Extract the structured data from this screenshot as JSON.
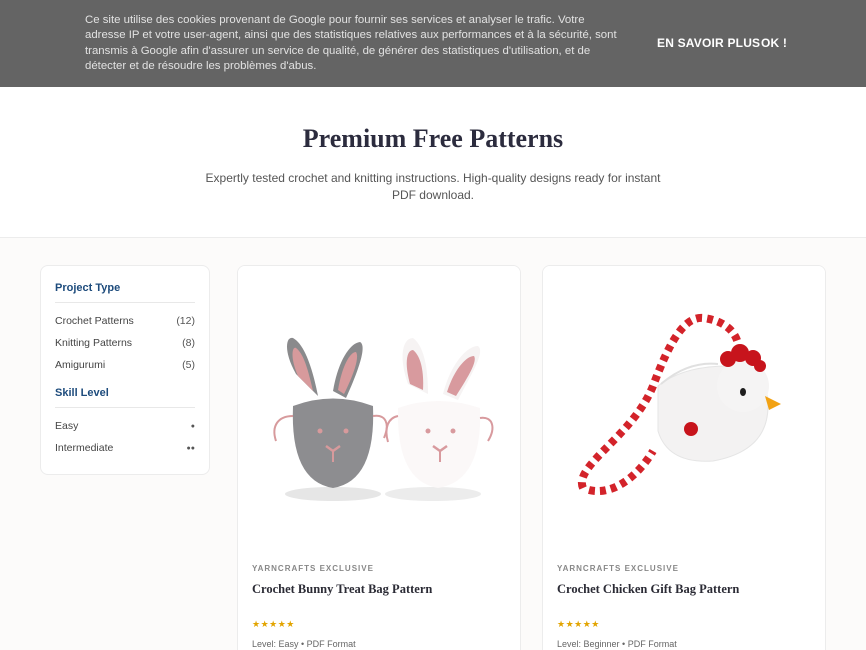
{
  "cookie_banner": {
    "text": "Ce site utilise des cookies provenant de Google pour fournir ses services et analyser le trafic. Votre adresse IP et votre user-agent, ainsi que des statistiques relatives aux performances et à la sécurité, sont transmis à Google afin d'assurer un service de qualité, de générer des statistiques d'utilisation, et de détecter et de résoudre les problèmes d'abus.",
    "learn_more": "EN SAVOIR PLUS",
    "ok": "OK !"
  },
  "hero": {
    "title": "Premium Free Patterns",
    "subtitle": "Expertly tested crochet and knitting instructions. High-quality designs ready for instant PDF download."
  },
  "sidebar": {
    "project_type_heading": "Project Type",
    "project_types": [
      {
        "label": "Crochet Patterns",
        "count": "(12)"
      },
      {
        "label": "Knitting Patterns",
        "count": "(8)"
      },
      {
        "label": "Amigurumi",
        "count": "(5)"
      }
    ],
    "skill_level_heading": "Skill Level",
    "skill_levels": [
      {
        "label": "Easy",
        "dots": "●"
      },
      {
        "label": "Intermediate",
        "dots": "●●"
      }
    ]
  },
  "cards": [
    {
      "tag": "YARNCRAFTS EXCLUSIVE",
      "title": "Crochet Bunny Treat Bag Pattern",
      "stars": "★★★★★",
      "meta": "Level: Easy • PDF Format",
      "image_icon": "crochet-bunnies"
    },
    {
      "tag": "YARNCRAFTS EXCLUSIVE",
      "title": "Crochet Chicken Gift Bag Pattern",
      "stars": "★★★★★",
      "meta": "Level: Beginner • PDF Format",
      "image_icon": "crochet-chicken-bag"
    }
  ],
  "colors": {
    "banner_bg": "#646464",
    "heading_blue": "#1d4b7c",
    "star_gold": "#e2a400"
  }
}
